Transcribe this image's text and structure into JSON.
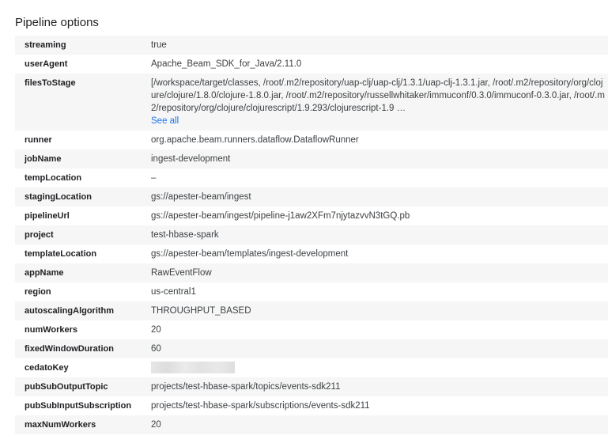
{
  "section_title": "Pipeline options",
  "options": [
    {
      "key": "streaming",
      "value": "true"
    },
    {
      "key": "userAgent",
      "value": "Apache_Beam_SDK_for_Java/2.11.0"
    },
    {
      "key": "filesToStage",
      "value": "[/workspace/target/classes, /root/.m2/repository/uap-clj/uap-clj/1.3.1/uap-clj-1.3.1.jar, /root/.m2/repository/org/clojure/clojure/1.8.0/clojure-1.8.0.jar, /root/.m2/repository/russellwhitaker/immuconf/0.3.0/immuconf-0.3.0.jar, /root/.m2/repository/org/clojure/clojurescript/1.9.293/clojurescript-1.9 …",
      "link": "See all"
    },
    {
      "key": "runner",
      "value": "org.apache.beam.runners.dataflow.DataflowRunner"
    },
    {
      "key": "jobName",
      "value": "ingest-development"
    },
    {
      "key": "tempLocation",
      "value": "–"
    },
    {
      "key": "stagingLocation",
      "value": "gs://apester-beam/ingest"
    },
    {
      "key": "pipelineUrl",
      "value": "gs://apester-beam/ingest/pipeline-j1aw2XFm7njytazvvN3tGQ.pb"
    },
    {
      "key": "project",
      "value": "test-hbase-spark"
    },
    {
      "key": "templateLocation",
      "value": "gs://apester-beam/templates/ingest-development"
    },
    {
      "key": "appName",
      "value": "RawEventFlow"
    },
    {
      "key": "region",
      "value": "us-central1"
    },
    {
      "key": "autoscalingAlgorithm",
      "value": "THROUGHPUT_BASED"
    },
    {
      "key": "numWorkers",
      "value": "20"
    },
    {
      "key": "fixedWindowDuration",
      "value": "60"
    },
    {
      "key": "cedatoKey",
      "value": ""
    },
    {
      "key": "pubSubOutputTopic",
      "value": "projects/test-hbase-spark/topics/events-sdk211"
    },
    {
      "key": "pubSubInputSubscription",
      "value": "projects/test-hbase-spark/subscriptions/events-sdk211"
    },
    {
      "key": "maxNumWorkers",
      "value": "20"
    }
  ]
}
